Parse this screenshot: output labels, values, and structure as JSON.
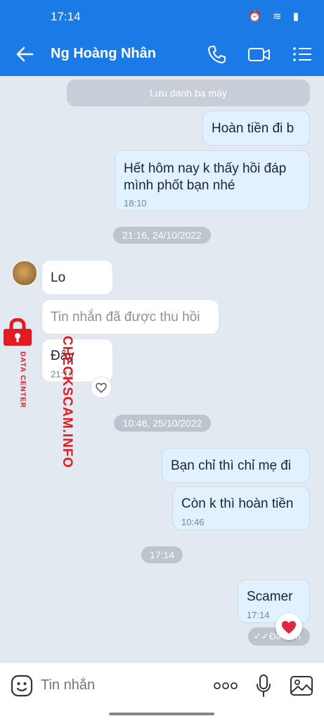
{
  "status_bar": {
    "time": "17:14",
    "icons": "⏰ ≋ ▮"
  },
  "header": {
    "title": "Ng Hoàng Nhân",
    "back_icon": "arrow-left-icon",
    "call_icon": "phone-icon",
    "video_icon": "video-icon",
    "menu_icon": "list-icon"
  },
  "system_notice": "Lưu danh bạ máy",
  "messages": [
    {
      "dir": "out",
      "text": "Hoàn tiền đi b"
    },
    {
      "dir": "out",
      "text": "Hết hôm nay k thấy hồi đáp mình phốt bạn nhé",
      "line1": "Hết hôm nay k thấy hồi đáp",
      "line2": "mình phốt bạn nhé",
      "time": "18:10"
    },
    {
      "dir": "in",
      "text": "Lo"
    },
    {
      "dir": "in",
      "text": "Tin nhắn đã được thu hồi"
    },
    {
      "dir": "in",
      "text": "Đây",
      "time": "21:16"
    },
    {
      "dir": "out",
      "text": "Bạn chỉ thì chỉ mẹ đi"
    },
    {
      "dir": "out",
      "text": "Còn k thì hoàn tiền",
      "time": "10:46"
    },
    {
      "dir": "out",
      "text": "Scamer",
      "time": "17:14"
    }
  ],
  "separators": [
    "21:16, 24/10/2022",
    "10:46, 25/10/2022",
    "17:14"
  ],
  "seen_status": "Đã xem",
  "input": {
    "placeholder": "Tin nhắn"
  },
  "watermark": {
    "main": "CHECKSCAM.INFO",
    "sub": "DATA CENTER"
  },
  "colors": {
    "header": "#1a7be6",
    "out_bubble": "#e1f1fe",
    "in_bubble": "#ffffff",
    "background": "#e2e9f1"
  }
}
